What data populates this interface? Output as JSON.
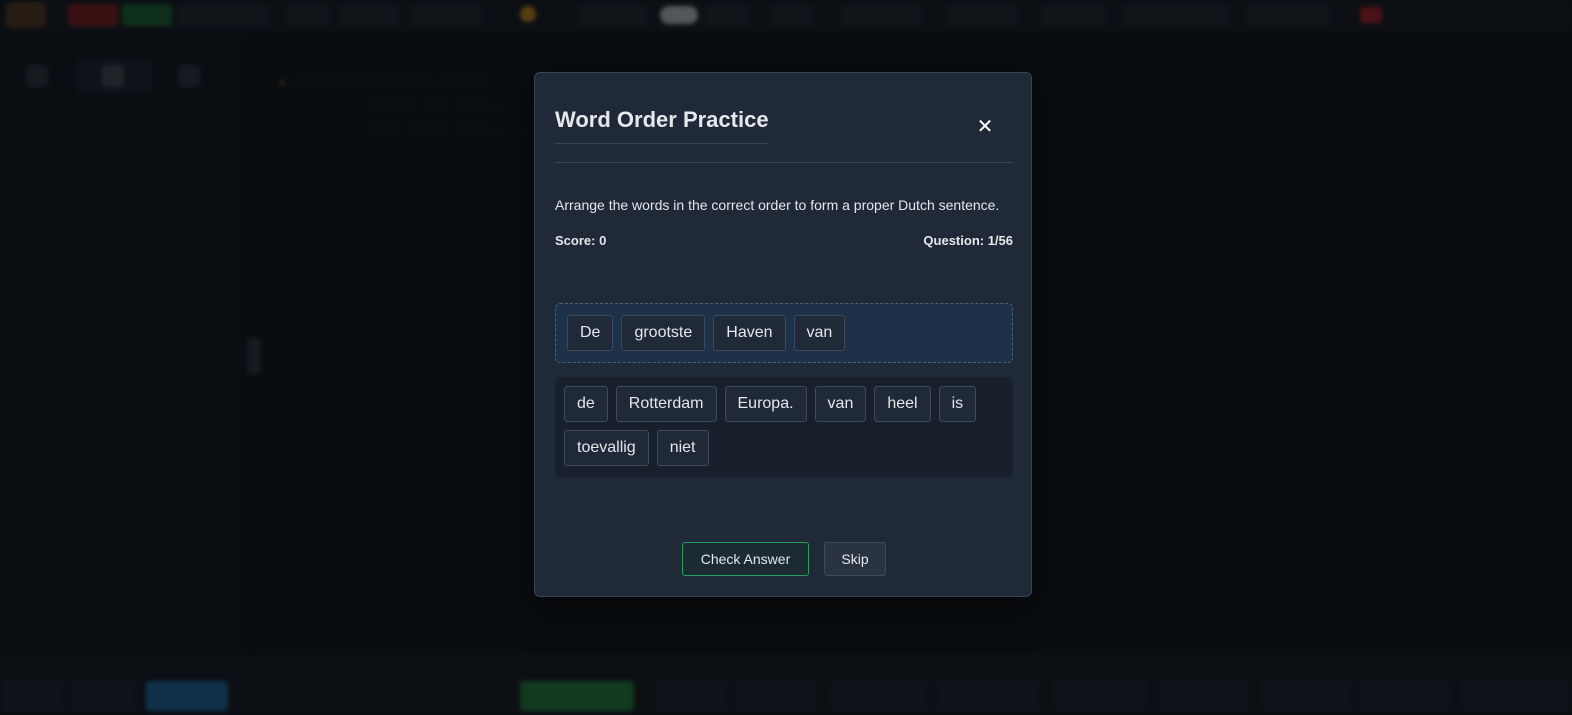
{
  "modal": {
    "title": "Word Order Practice",
    "close_glyph": "✕",
    "instructions": "Arrange the words in the correct order to form a proper Dutch sentence.",
    "score_label": "Score: 0",
    "question_label": "Question: 1/56",
    "answer_words": [
      "De",
      "grootste",
      "Haven",
      "van"
    ],
    "bank_words": [
      "de",
      "Rotterdam",
      "Europa.",
      "van",
      "heel",
      "is",
      "toevallig",
      "niet"
    ],
    "check_label": "Check Answer",
    "skip_label": "Skip"
  },
  "background": {
    "colors": {
      "page": "#0d1117",
      "modal": "#1f2937",
      "answer_zone": "#1d3149",
      "check_border": "#23a05a"
    },
    "icons": [
      "folder-icon",
      "book-icon",
      "search-icon",
      "close-icon"
    ]
  }
}
